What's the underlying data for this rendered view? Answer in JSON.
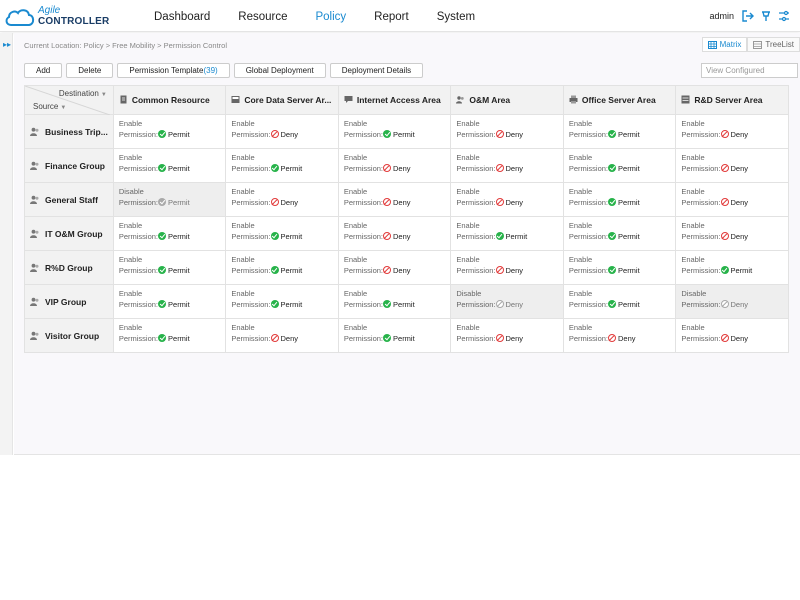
{
  "brand": {
    "line1": "Agile",
    "line2": "CONTROLLER"
  },
  "nav": [
    {
      "label": "Dashboard",
      "active": false
    },
    {
      "label": "Resource",
      "active": false
    },
    {
      "label": "Policy",
      "active": true
    },
    {
      "label": "Report",
      "active": false
    },
    {
      "label": "System",
      "active": false
    }
  ],
  "user": {
    "name": "admin"
  },
  "breadcrumb": "Current Location: Policy > Free Mobility > Permission Control",
  "view_tabs": {
    "matrix": "Matrix",
    "treelist": "TreeList",
    "active": "Matrix"
  },
  "toolbar": {
    "add": "Add",
    "delete": "Delete",
    "permission_template": "Permission Template",
    "permission_template_count": "(39)",
    "global_deployment": "Global Deployment",
    "deployment_details": "Deployment Details"
  },
  "filter": {
    "value": "View Configured"
  },
  "matrix": {
    "corner": {
      "destination": "Destination",
      "source": "Source"
    },
    "status_labels": {
      "enable": "Enable",
      "disable": "Disable",
      "permission": "Permission:"
    },
    "columns": [
      {
        "label": "Common Resource",
        "icon": "document-icon"
      },
      {
        "label": "Core Data Server Ar...",
        "icon": "server-icon"
      },
      {
        "label": "Internet Access Area",
        "icon": "chat-icon"
      },
      {
        "label": "O&M Area",
        "icon": "users-icon"
      },
      {
        "label": "Office Server Area",
        "icon": "printer-icon"
      },
      {
        "label": "R&D Server Area",
        "icon": "server-rack-icon"
      }
    ],
    "rows": [
      {
        "label": "Business Trip...",
        "cells": [
          {
            "status": "Enable",
            "permission": "Permit"
          },
          {
            "status": "Enable",
            "permission": "Deny"
          },
          {
            "status": "Enable",
            "permission": "Permit"
          },
          {
            "status": "Enable",
            "permission": "Deny"
          },
          {
            "status": "Enable",
            "permission": "Permit"
          },
          {
            "status": "Enable",
            "permission": "Deny"
          }
        ]
      },
      {
        "label": "Finance Group",
        "cells": [
          {
            "status": "Enable",
            "permission": "Permit"
          },
          {
            "status": "Enable",
            "permission": "Permit"
          },
          {
            "status": "Enable",
            "permission": "Deny"
          },
          {
            "status": "Enable",
            "permission": "Deny"
          },
          {
            "status": "Enable",
            "permission": "Permit"
          },
          {
            "status": "Enable",
            "permission": "Deny"
          }
        ]
      },
      {
        "label": "General Staff",
        "cells": [
          {
            "status": "Disable",
            "permission": "Permit"
          },
          {
            "status": "Enable",
            "permission": "Deny"
          },
          {
            "status": "Enable",
            "permission": "Deny"
          },
          {
            "status": "Enable",
            "permission": "Deny"
          },
          {
            "status": "Enable",
            "permission": "Permit"
          },
          {
            "status": "Enable",
            "permission": "Deny"
          }
        ]
      },
      {
        "label": "IT O&M Group",
        "cells": [
          {
            "status": "Enable",
            "permission": "Permit"
          },
          {
            "status": "Enable",
            "permission": "Permit"
          },
          {
            "status": "Enable",
            "permission": "Deny"
          },
          {
            "status": "Enable",
            "permission": "Permit"
          },
          {
            "status": "Enable",
            "permission": "Permit"
          },
          {
            "status": "Enable",
            "permission": "Deny"
          }
        ]
      },
      {
        "label": "R%D Group",
        "cells": [
          {
            "status": "Enable",
            "permission": "Permit"
          },
          {
            "status": "Enable",
            "permission": "Permit"
          },
          {
            "status": "Enable",
            "permission": "Deny"
          },
          {
            "status": "Enable",
            "permission": "Deny"
          },
          {
            "status": "Enable",
            "permission": "Permit"
          },
          {
            "status": "Enable",
            "permission": "Permit"
          }
        ]
      },
      {
        "label": "VIP Group",
        "cells": [
          {
            "status": "Enable",
            "permission": "Permit"
          },
          {
            "status": "Enable",
            "permission": "Permit"
          },
          {
            "status": "Enable",
            "permission": "Permit"
          },
          {
            "status": "Disable",
            "permission": "Deny"
          },
          {
            "status": "Enable",
            "permission": "Permit"
          },
          {
            "status": "Disable",
            "permission": "Deny"
          }
        ]
      },
      {
        "label": "Visitor Group",
        "cells": [
          {
            "status": "Enable",
            "permission": "Permit"
          },
          {
            "status": "Enable",
            "permission": "Deny"
          },
          {
            "status": "Enable",
            "permission": "Permit"
          },
          {
            "status": "Enable",
            "permission": "Deny"
          },
          {
            "status": "Enable",
            "permission": "Deny"
          },
          {
            "status": "Enable",
            "permission": "Deny"
          }
        ]
      }
    ]
  },
  "colors": {
    "accent": "#1a8ad0",
    "permit": "#27b34a",
    "deny": "#e23b3b",
    "disabled": "#a9a9a9"
  }
}
